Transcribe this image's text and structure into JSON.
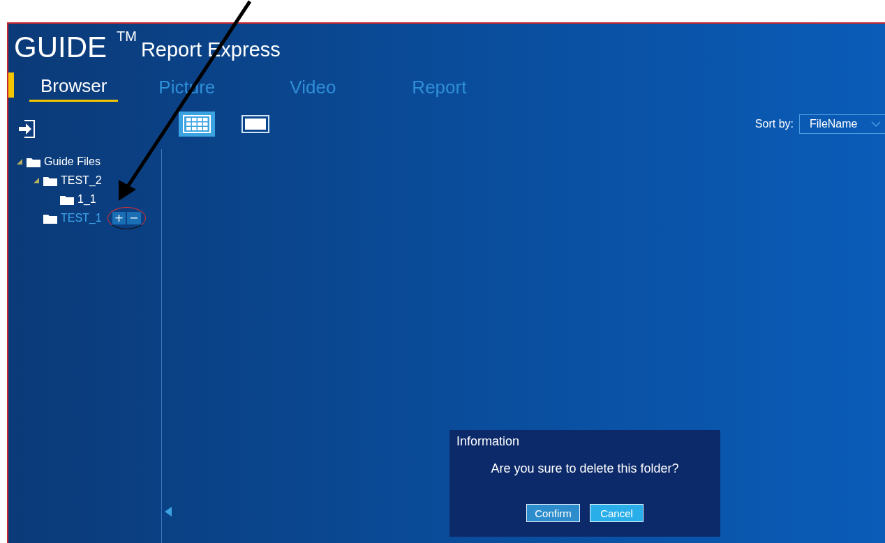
{
  "window": {
    "brand": "GUIDE",
    "trademark": "TM",
    "title": "Report Express"
  },
  "tabs": [
    {
      "label": "Browser",
      "selected": true
    },
    {
      "label": "Picture",
      "selected": false
    },
    {
      "label": "Video",
      "selected": false
    },
    {
      "label": "Report",
      "selected": false
    }
  ],
  "toolbar": {
    "views": [
      {
        "kind": "grid",
        "selected": true
      },
      {
        "kind": "single",
        "selected": false
      }
    ],
    "sort": {
      "label": "Sort by:",
      "value": "FileName"
    }
  },
  "tree": [
    {
      "label": "Guide Files",
      "expanded": true,
      "selected": false,
      "children": [
        {
          "label": "TEST_2",
          "expanded": true,
          "selected": false,
          "children": [
            {
              "label": "1_1",
              "selected": false
            }
          ]
        },
        {
          "label": "TEST_1",
          "selected": true,
          "actions": [
            "+",
            "−"
          ]
        }
      ]
    }
  ],
  "dialog": {
    "title": "Information",
    "message": "Are you sure to delete this folder?",
    "buttons": [
      {
        "label": "Confirm",
        "focused": true
      },
      {
        "label": "Cancel",
        "focused": false
      }
    ]
  }
}
